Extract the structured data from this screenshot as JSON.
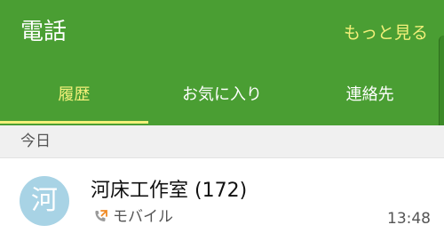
{
  "appbar": {
    "title": "電話",
    "more_label": "もっと見る",
    "background": "#4a9e33",
    "accent": "#f3f07a"
  },
  "tabs": [
    {
      "label": "履歴",
      "active": true
    },
    {
      "label": "お気に入り",
      "active": false
    },
    {
      "label": "連絡先",
      "active": false
    }
  ],
  "log": {
    "section_label": "今日",
    "items": [
      {
        "avatar_letter": "河",
        "name": "河床工作室 (172)",
        "call_icon": "outgoing-call-icon",
        "call_type": "モバイル",
        "time": "13:48"
      }
    ]
  }
}
